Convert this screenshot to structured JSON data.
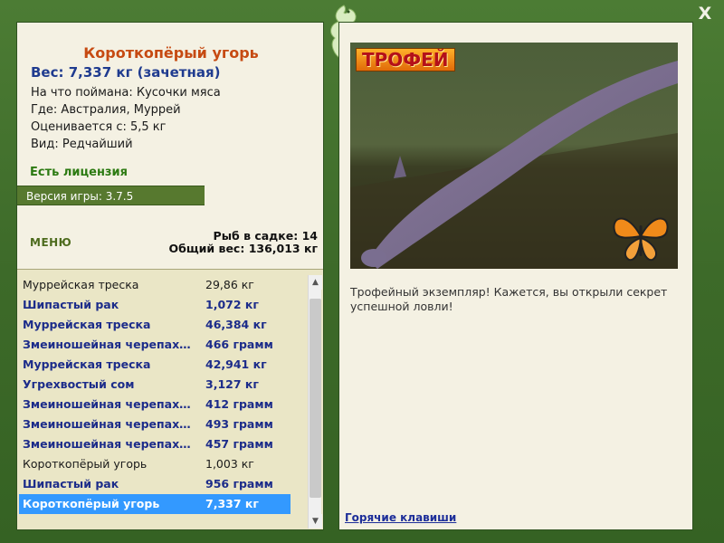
{
  "window": {
    "close_label": "X"
  },
  "fish": {
    "title": "Короткопёрый угорь",
    "weight_line": "Вес: 7,337 кг (зачетная)",
    "info": [
      "На что поймана: Кусочки мяса",
      "Где: Австралия, Муррей",
      "Оценивается с: 5,5 кг",
      "Вид: Редчайший"
    ]
  },
  "license_text": "Есть лицензия",
  "version_text": "Версия игры: 3.7.5",
  "menu_label": "МЕНЮ",
  "stats": {
    "keep_count": "Рыб в садке: 14",
    "total_weight": "Общий вес: 136,013 кг"
  },
  "catch_list": [
    {
      "name": "Муррейская треска",
      "weight": "29,86 кг",
      "style": "plain"
    },
    {
      "name": "Шипастый рак",
      "weight": "1,072 кг",
      "style": "bold"
    },
    {
      "name": "Муррейская треска",
      "weight": "46,384 кг",
      "style": "bold"
    },
    {
      "name": "Змеиношейная черепах…",
      "weight": "466 грамм",
      "style": "bold"
    },
    {
      "name": "Муррейская треска",
      "weight": "42,941 кг",
      "style": "bold"
    },
    {
      "name": "Угрехвостый сом",
      "weight": "3,127 кг",
      "style": "bold"
    },
    {
      "name": "Змеиношейная черепах…",
      "weight": "412 грамм",
      "style": "bold"
    },
    {
      "name": "Змеиношейная черепах…",
      "weight": "493 грамм",
      "style": "bold"
    },
    {
      "name": "Змеиношейная черепах…",
      "weight": "457 грамм",
      "style": "bold"
    },
    {
      "name": "Короткопёрый угорь",
      "weight": "1,003 кг",
      "style": "plain"
    },
    {
      "name": "Шипастый рак",
      "weight": "956 грамм",
      "style": "bold"
    },
    {
      "name": "Короткопёрый угорь",
      "weight": "7,337 кг",
      "style": "selected"
    }
  ],
  "trophy_label": "ТРОФЕЙ",
  "caption": "Трофейный экземпляр! Кажется, вы открыли секрет успешной ловли!",
  "hotkeys_label": "Горячие клавиши",
  "icons": {
    "close": "close-icon",
    "logo": "lizard-logo-icon",
    "butterfly": "butterfly-icon",
    "scroll_up": "scroll-up-arrow-icon",
    "scroll_down": "scroll-down-arrow-icon"
  },
  "colors": {
    "frame": "#3f6b2c",
    "title": "#c64a12",
    "weight": "#1f3b8f",
    "license": "#2c7a12",
    "version_bar": "#57792f",
    "selection": "#3399ff",
    "link": "#1d2e99"
  }
}
